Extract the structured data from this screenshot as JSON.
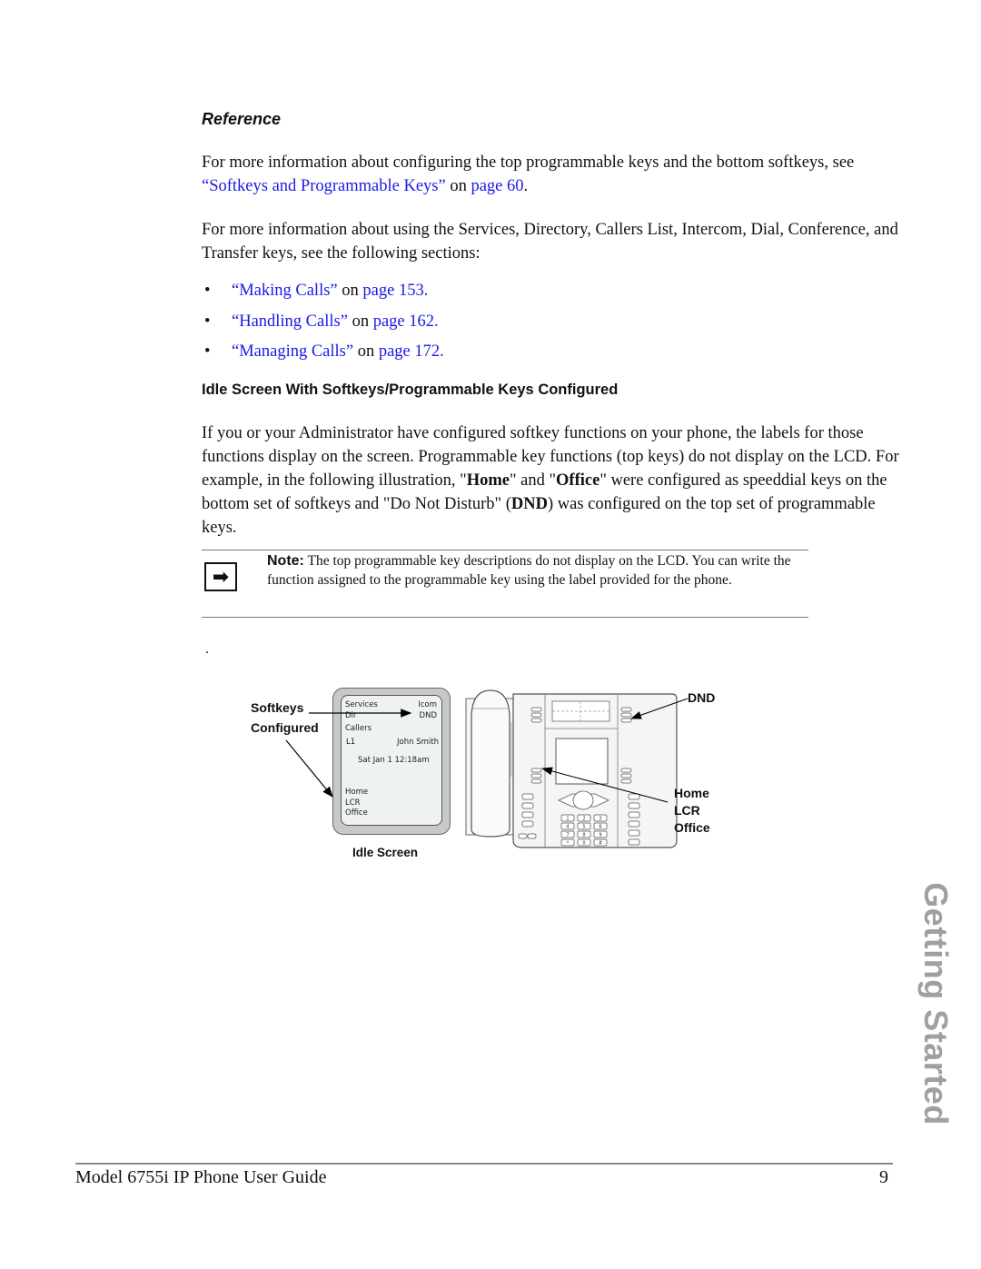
{
  "reference": {
    "heading": "Reference",
    "para1_text": "For more information about configuring the top programmable keys and the bottom softkeys, see ",
    "para1_link": "“Softkeys and Programmable Keys”",
    "para1_on": " on ",
    "para1_page_link": "page 60",
    "para1_end": ".",
    "para2": "For more information about using the Services, Directory, Callers List, Intercom, Dial, Conference, and Transfer keys, see the following sections:",
    "bullets": [
      {
        "marker": "•",
        "link": "“Making Calls”",
        "on": " on ",
        "page_link": "page 153."
      },
      {
        "marker": "•",
        "link": "“Handling Calls”",
        "on": " on ",
        "page_link": "page 162."
      },
      {
        "marker": "•",
        "link": "“Managing Calls”",
        "on": " on ",
        "page_link": "page 172."
      }
    ]
  },
  "idle_section": {
    "heading": "Idle Screen With Softkeys/Programmable Keys Configured",
    "para_parts": [
      "If you or your Administrator have configured softkey functions on your phone, the labels for those functions display on the screen. Programmable key functions (top keys) do not display on the LCD. For example, in the following illustration, \"",
      "Home",
      "\" and \"",
      "Office",
      "\" were configured as speeddial keys on the bottom set of softkeys and \"Do Not Disturb\" (",
      "DND",
      ") was configured on the top set of programmable keys."
    ]
  },
  "note": {
    "icon": "arrow-right-icon",
    "icon_glyph": "➡",
    "label": "Note:",
    "text": " The top programmable key descriptions do not display on the LCD. You can write the function assigned to the programmable key using the label provided for the phone."
  },
  "stray_dot": ".",
  "figure": {
    "callout_softkeys": "Softkeys",
    "callout_configured": "Configured",
    "caption": "Idle Screen",
    "lcd": {
      "top_left": "Services",
      "top_right": "Icom",
      "row2_left": "Dir",
      "row2_right": "DND",
      "row3_left": "Callers",
      "line": "L1",
      "name": "John Smith",
      "datetime": "Sat  Jan 1  12:18am",
      "bottom1": "Home",
      "bottom2": "LCR",
      "bottom3": "Office"
    },
    "phone_callout_top": "DND",
    "phone_callout_bottom": [
      "Home",
      "LCR",
      "Office"
    ],
    "keypad": [
      "1",
      "2",
      "3",
      "4",
      "5",
      "6",
      "7",
      "8",
      "9",
      "*",
      "0",
      "#"
    ]
  },
  "side_tab": "Getting Started",
  "footer": {
    "title": "Model 6755i IP Phone User Guide",
    "page": "9"
  }
}
